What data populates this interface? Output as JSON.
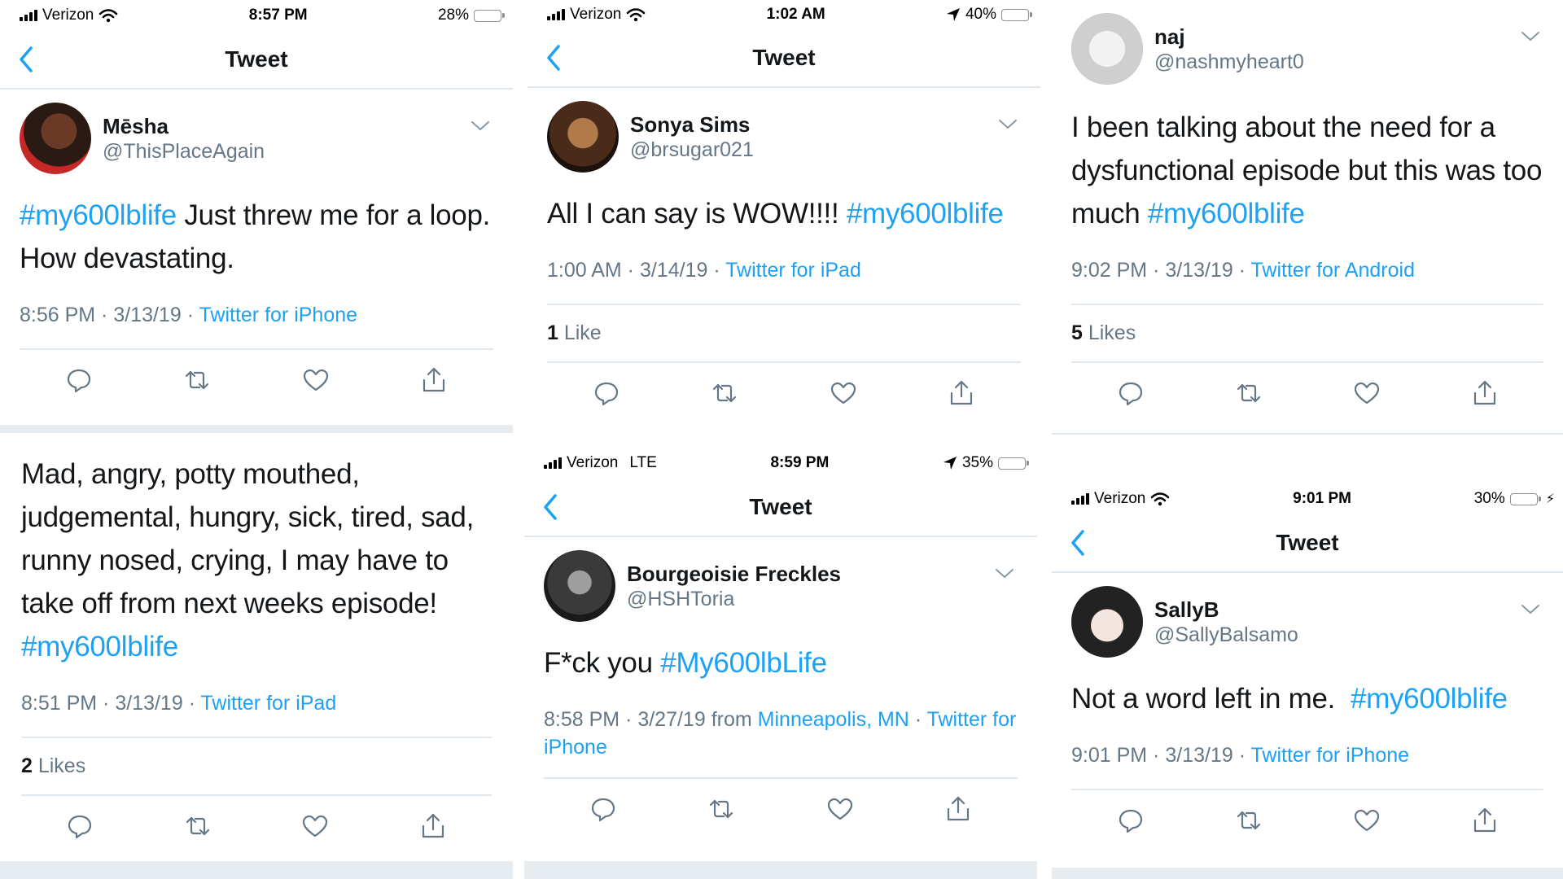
{
  "colors": {
    "accent": "#1da1f2",
    "muted": "#657786",
    "divider": "#e1e8ed",
    "battery_green": "#4cd964",
    "battery_black": "#000000"
  },
  "panels": {
    "p1": {
      "status": {
        "carrier": "Verizon",
        "time": "8:57 PM",
        "battery": "28%",
        "battery_level": 0.28
      },
      "nav_title": "Tweet",
      "user": {
        "display_name": "Mēsha",
        "handle": "@ThisPlaceAgain"
      },
      "text": {
        "hashtag": "#my600lblife",
        "body": " Just threw me for a loop. How devastating."
      },
      "meta": {
        "time": "8:56 PM",
        "sep1": " · ",
        "date": "3/13/19",
        "sep2": " · ",
        "source": "Twitter for iPhone"
      }
    },
    "p2": {
      "status": {
        "carrier": "Verizon",
        "time": "1:02 AM",
        "battery": "40%",
        "battery_level": 0.4
      },
      "nav_title": "Tweet",
      "user": {
        "display_name": "Sonya Sims",
        "handle": "@brsugar021"
      },
      "text": {
        "body": "All I can say is WOW!!!! ",
        "hashtag": "#my600lblife"
      },
      "meta": {
        "time": "1:00 AM",
        "sep1": " · ",
        "date": "3/14/19",
        "sep2": " · ",
        "source": "Twitter for iPad"
      },
      "likes": {
        "count": "1",
        "label": " Like"
      }
    },
    "p3": {
      "user": {
        "display_name": "naj",
        "handle": "@nashmyheart0"
      },
      "text": {
        "body": "I been talking about the need for a dysfunctional episode but this was too much ",
        "hashtag": "#my600lblife"
      },
      "meta": {
        "time": "9:02 PM",
        "sep1": " · ",
        "date": "3/13/19",
        "sep2": " · ",
        "source": "Twitter for Android"
      },
      "likes": {
        "count": "5",
        "label": " Likes"
      }
    },
    "p4": {
      "text": {
        "body": "Mad, angry, potty mouthed, judgemental, hungry, sick, tired, sad, runny nosed, crying, I may have to take off from next weeks episode! ",
        "hashtag": "#my600lblife"
      },
      "meta": {
        "time": "8:51 PM",
        "sep1": " · ",
        "date": "3/13/19",
        "sep2": " · ",
        "source": "Twitter for iPad"
      },
      "likes": {
        "count": "2",
        "label": " Likes"
      }
    },
    "p5": {
      "status": {
        "carrier": "Verizon",
        "network": "LTE",
        "time": "8:59 PM",
        "battery": "35%",
        "battery_level": 0.35
      },
      "nav_title": "Tweet",
      "user": {
        "display_name": "Bourgeoisie Freckles",
        "handle": "@HSHToria"
      },
      "text": {
        "body": "F*ck you ",
        "hashtag": "#My600lbLife"
      },
      "meta": {
        "time": "8:58 PM",
        "sep1": " · ",
        "date": "3/27/19",
        "from": " from ",
        "location": "Minneapolis, MN",
        "sep2": " · ",
        "source": "Twitter for iPhone"
      }
    },
    "p6": {
      "status": {
        "carrier": "Verizon",
        "time": "9:01 PM",
        "battery": "30%",
        "battery_level": 0.3
      },
      "nav_title": "Tweet",
      "user": {
        "display_name": "SallyB",
        "handle": "@SallyBalsamo"
      },
      "text": {
        "body": "Not a word left in me.  ",
        "hashtag": "#my600lblife"
      },
      "meta": {
        "time": "9:01 PM",
        "sep1": " · ",
        "date": "3/13/19",
        "sep2": " · ",
        "source": "Twitter for iPhone"
      }
    }
  },
  "icons": {
    "reply": "reply-icon",
    "retweet": "retweet-icon",
    "like": "heart-icon",
    "share": "share-icon",
    "back": "back-chevron-icon",
    "more": "chevron-down-icon"
  }
}
